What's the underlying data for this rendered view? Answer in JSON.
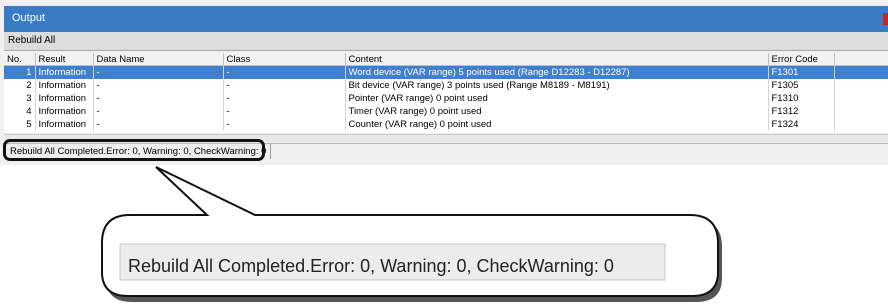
{
  "window": {
    "title": "Output"
  },
  "toolbar": {
    "label": "Rebuild All"
  },
  "table": {
    "headers": [
      "No.",
      "Result",
      "Data Name",
      "Class",
      "Content",
      "Error Code",
      ""
    ],
    "rows": [
      [
        "1",
        "Information",
        "-",
        "-",
        "Word device (VAR range) 5 points used (Range D12283 - D12287)",
        "F1301",
        ""
      ],
      [
        "2",
        "Information",
        "-",
        "-",
        "Bit device (VAR range) 3 points used (Range M8189 - M8191)",
        "F1305",
        ""
      ],
      [
        "3",
        "Information",
        "-",
        "-",
        "Pointer (VAR range) 0 point used",
        "F1310",
        ""
      ],
      [
        "4",
        "Information",
        "-",
        "-",
        "Timer (VAR range) 0 point used",
        "F1312",
        ""
      ],
      [
        "5",
        "Information",
        "-",
        "-",
        "Counter (VAR range) 0 point used",
        "F1324",
        ""
      ]
    ],
    "selected_row": 1
  },
  "status": {
    "text": "Rebuild All Completed.Error: 0, Warning: 0, CheckWarning: 0"
  },
  "callout": {
    "text": "Rebuild All Completed.Error: 0, Warning: 0, CheckWarning: 0"
  }
}
